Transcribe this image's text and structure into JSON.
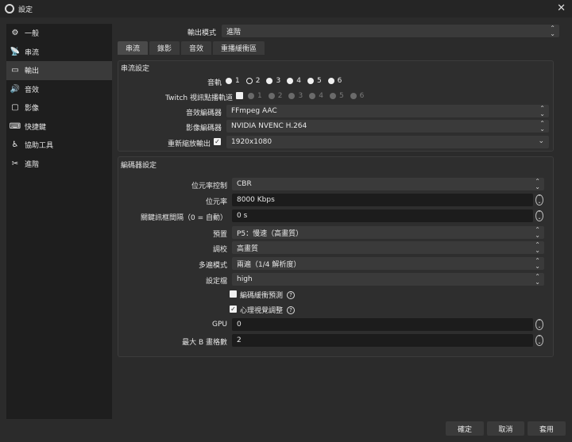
{
  "window": {
    "title": "設定"
  },
  "sidebar": {
    "items": [
      {
        "label": "一般",
        "icon": "gear-icon"
      },
      {
        "label": "串流",
        "icon": "antenna-icon"
      },
      {
        "label": "輸出",
        "icon": "output-icon"
      },
      {
        "label": "音效",
        "icon": "speaker-icon"
      },
      {
        "label": "影像",
        "icon": "monitor-icon"
      },
      {
        "label": "快捷鍵",
        "icon": "keyboard-icon"
      },
      {
        "label": "協助工具",
        "icon": "accessibility-icon"
      },
      {
        "label": "進階",
        "icon": "tools-icon"
      }
    ]
  },
  "output_mode": {
    "label": "輸出模式",
    "value": "進階"
  },
  "tabs": [
    "串流",
    "錄影",
    "音效",
    "重播緩衝區"
  ],
  "streaming_settings": {
    "title": "串流設定",
    "audio_track_label": "音軌",
    "tracks": [
      "1",
      "2",
      "3",
      "4",
      "5",
      "6"
    ],
    "twitch_label": "Twitch 視訊點播軌道",
    "audio_encoder_label": "音效編碼器",
    "audio_encoder_value": "FFmpeg AAC",
    "video_encoder_label": "影像編碼器",
    "video_encoder_value": "NVIDIA NVENC H.264",
    "rescale_label": "重新縮放輸出",
    "rescale_value": "1920x1080"
  },
  "encoder_settings": {
    "title": "編碼器設定",
    "rate_control_label": "位元率控制",
    "rate_control_value": "CBR",
    "bitrate_label": "位元率",
    "bitrate_value": "8000 Kbps",
    "keyframe_label": "關鍵訊框間隔（0 = 自動）",
    "keyframe_value": "0 s",
    "preset_label": "預置",
    "preset_value": "P5：慢速（高畫質）",
    "tuning_label": "調校",
    "tuning_value": "高畫質",
    "multipass_label": "多遍模式",
    "multipass_value": "兩遍（1/4 解析度）",
    "profile_label": "設定檔",
    "profile_value": "high",
    "lookahead_label": "編碼緩衝預測",
    "psycho_label": "心理視覺調整",
    "gpu_label": "GPU",
    "gpu_value": "0",
    "bframes_label": "最大 B 畫格數",
    "bframes_value": "2"
  },
  "footer": {
    "ok": "確定",
    "cancel": "取消",
    "apply": "套用"
  }
}
